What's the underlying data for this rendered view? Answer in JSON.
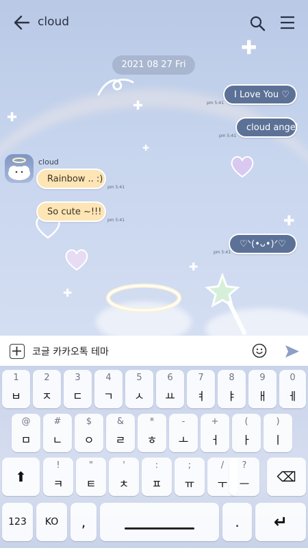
{
  "header": {
    "title": "cloud"
  },
  "date_divider": "2021 08 27 Fri",
  "messages": [
    {
      "side": "me",
      "text": "I Love You ♡",
      "time": "pm 5:41"
    },
    {
      "side": "me",
      "text": "cloud angel",
      "time": "pm 5:41"
    },
    {
      "side": "them",
      "text": "Rainbow .. :)",
      "time": "pm 5:41"
    },
    {
      "side": "them",
      "text": "So cute ~!!!",
      "time": "pm 5:41"
    },
    {
      "side": "me",
      "text": "♡ᐠ(•ᴗ•)ᐟ♡",
      "time": "pm 5:41"
    }
  ],
  "sender_name": "cloud",
  "input": {
    "value": "코글 카카오톡 테마"
  },
  "keyboard": {
    "row1": [
      {
        "hint": "1",
        "main": "ㅂ"
      },
      {
        "hint": "2",
        "main": "ㅈ"
      },
      {
        "hint": "3",
        "main": "ㄷ"
      },
      {
        "hint": "4",
        "main": "ㄱ"
      },
      {
        "hint": "5",
        "main": "ㅅ"
      },
      {
        "hint": "6",
        "main": "ㅛ"
      },
      {
        "hint": "7",
        "main": "ㅕ"
      },
      {
        "hint": "8",
        "main": "ㅑ"
      },
      {
        "hint": "9",
        "main": "ㅐ"
      },
      {
        "hint": "0",
        "main": "ㅔ"
      }
    ],
    "row2": [
      {
        "hint": "@",
        "main": "ㅁ"
      },
      {
        "hint": "#",
        "main": "ㄴ"
      },
      {
        "hint": "$",
        "main": "ㅇ"
      },
      {
        "hint": "&",
        "main": "ㄹ"
      },
      {
        "hint": "*",
        "main": "ㅎ"
      },
      {
        "hint": "-",
        "main": "ㅗ"
      },
      {
        "hint": "+",
        "main": "ㅓ"
      },
      {
        "hint": "(",
        "main": "ㅏ"
      },
      {
        "hint": ")",
        "main": "ㅣ"
      }
    ],
    "row3": [
      {
        "hint": "!",
        "main": "ㅋ"
      },
      {
        "hint": "\"",
        "main": "ㅌ"
      },
      {
        "hint": "'",
        "main": "ㅊ"
      },
      {
        "hint": ":",
        "main": "ㅍ"
      },
      {
        "hint": ";",
        "main": "ㅠ"
      },
      {
        "hint": "/",
        "main": "ㅜ"
      },
      {
        "hint": "?",
        "main": "ㅡ"
      }
    ],
    "shift_label": "⬆",
    "backspace_label": "⌫",
    "num_label": "123",
    "lang_label": "KO",
    "comma_label": ",",
    "period_label": ".",
    "enter_label": "↵"
  },
  "colors": {
    "my_bubble": "#5c7196",
    "their_bubble": "#fde5b5",
    "send": "#8d9fc6"
  }
}
